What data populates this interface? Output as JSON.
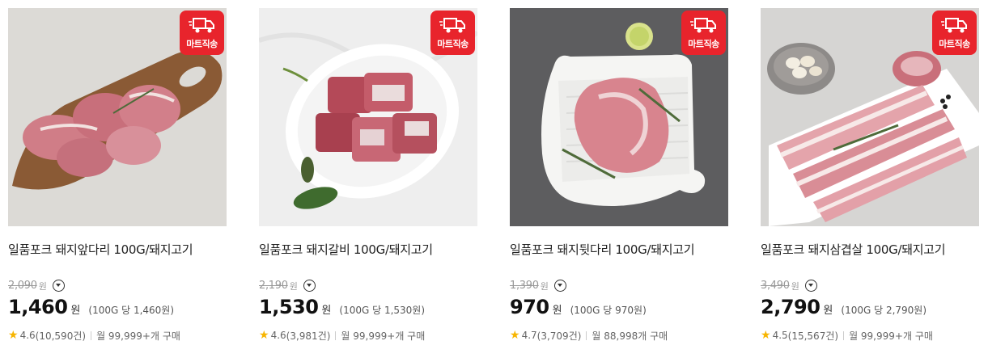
{
  "badge_label": "마트직송",
  "products": [
    {
      "title": "일품포크 돼지앞다리 100G/돼지고기",
      "original_price": "2,090",
      "original_won": "원",
      "price": "1,460",
      "won": "원",
      "unit_price": "(100G 당 1,460원)",
      "rating": "4.6",
      "reviews": "(10,590건)",
      "monthly": "월 99,999+개 구매"
    },
    {
      "title": "일품포크 돼지갈비 100G/돼지고기",
      "original_price": "2,190",
      "original_won": "원",
      "price": "1,530",
      "won": "원",
      "unit_price": "(100G 당 1,530원)",
      "rating": "4.6",
      "reviews": "(3,981건)",
      "monthly": "월 99,999+개 구매"
    },
    {
      "title": "일품포크 돼지뒷다리 100G/돼지고기",
      "original_price": "1,390",
      "original_won": "원",
      "price": "970",
      "won": "원",
      "unit_price": "(100G 당 970원)",
      "rating": "4.7",
      "reviews": "(3,709건)",
      "monthly": "월 88,998개 구매"
    },
    {
      "title": "일품포크 돼지삼겹살 100G/돼지고기",
      "original_price": "3,490",
      "original_won": "원",
      "price": "2,790",
      "won": "원",
      "unit_price": "(100G 당 2,790원)",
      "rating": "4.5",
      "reviews": "(15,567건)",
      "monthly": "월 99,999+개 구매"
    }
  ],
  "colors": {
    "badge": "#e8242c",
    "star": "#f7b500",
    "meat": "#c9737d"
  }
}
